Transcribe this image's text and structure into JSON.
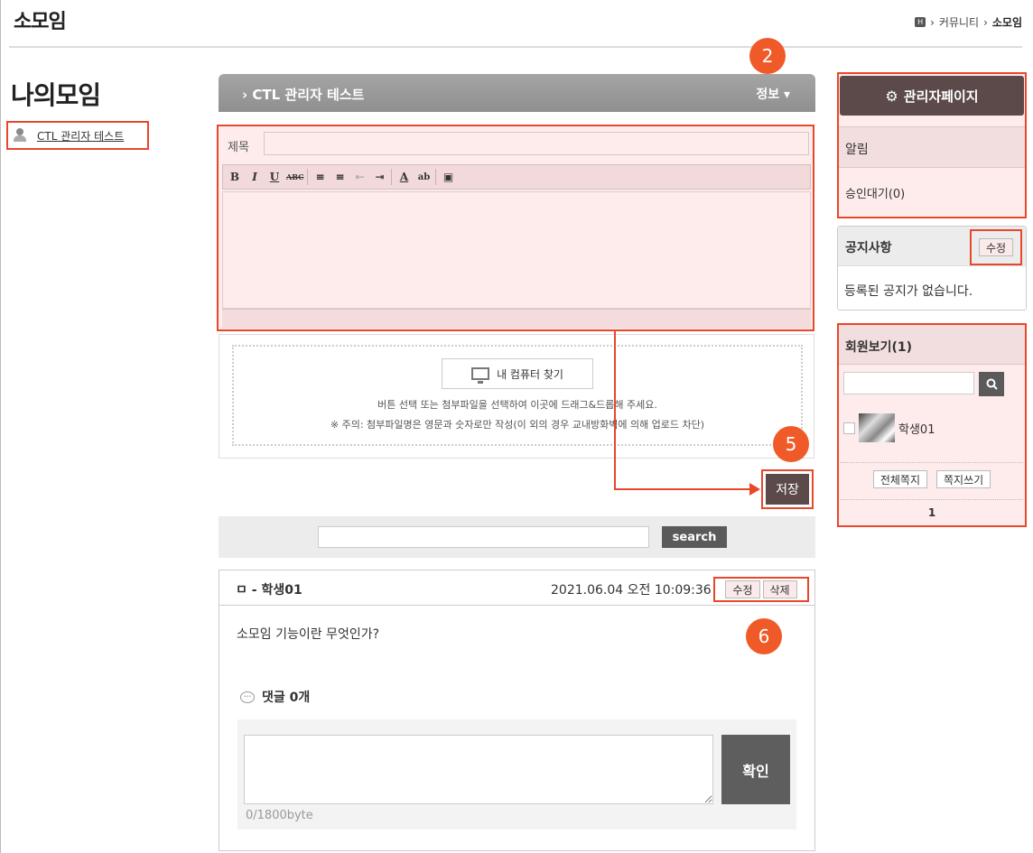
{
  "page": {
    "title": "소모임"
  },
  "breadcrumb": {
    "home_icon": "H",
    "sep": "›",
    "level1": "커뮤니티",
    "level2": "소모임"
  },
  "sidebar": {
    "title": "나의모임",
    "group_link": "CTL 관리자 테스트"
  },
  "group": {
    "name": "› CTL 관리자 테스트",
    "info_label": "정보 ▾"
  },
  "editor": {
    "subject_label": "제목",
    "subject_value": "",
    "toolbar": [
      "B",
      "I",
      "U",
      "ABC",
      "≡",
      "≡",
      "⇤",
      "⇥",
      "A",
      "ab",
      "▣"
    ]
  },
  "upload": {
    "button_label": "내 컴퓨터 찾기",
    "message1": "버튼 선택 또는 첨부파일을 선택하여 이곳에 드래그&드롭해 주세요.",
    "message2": "※ 주의: 첨부파일명은 영문과 숫자로만 작성(이 외의 경우 교내방화벽에 의해 업로드 차단)"
  },
  "save_label": "저장",
  "search": {
    "value": "",
    "button_label": "search"
  },
  "post": {
    "author": "ㅁ - 학생01",
    "date": "2021.06.04 오전 10:09:36",
    "edit_label": "수정",
    "delete_label": "삭제",
    "body": "소모임 기능이란 무엇인가?",
    "comment_label": "댓글 0개",
    "comment_value": "",
    "confirm_label": "확인",
    "byte_count": "0/1800byte"
  },
  "admin": {
    "button_label": "관리자페이지",
    "alert_title": "알림",
    "pending": "승인대기(0)"
  },
  "notice": {
    "title": "공지사항",
    "edit_label": "수정",
    "empty": "등록된 공지가 없습니다."
  },
  "members": {
    "title": "회원보기(1)",
    "search_value": "",
    "list": [
      {
        "name": "학생01"
      }
    ],
    "all_message_label": "전체쪽지",
    "write_message_label": "쪽지쓰기",
    "page": "1"
  },
  "badges": {
    "b2": "2",
    "b5": "5",
    "b6": "6"
  },
  "colors": {
    "highlight": "#e8472c",
    "badge": "#f05a28",
    "dark_button": "#5c4a4a"
  }
}
